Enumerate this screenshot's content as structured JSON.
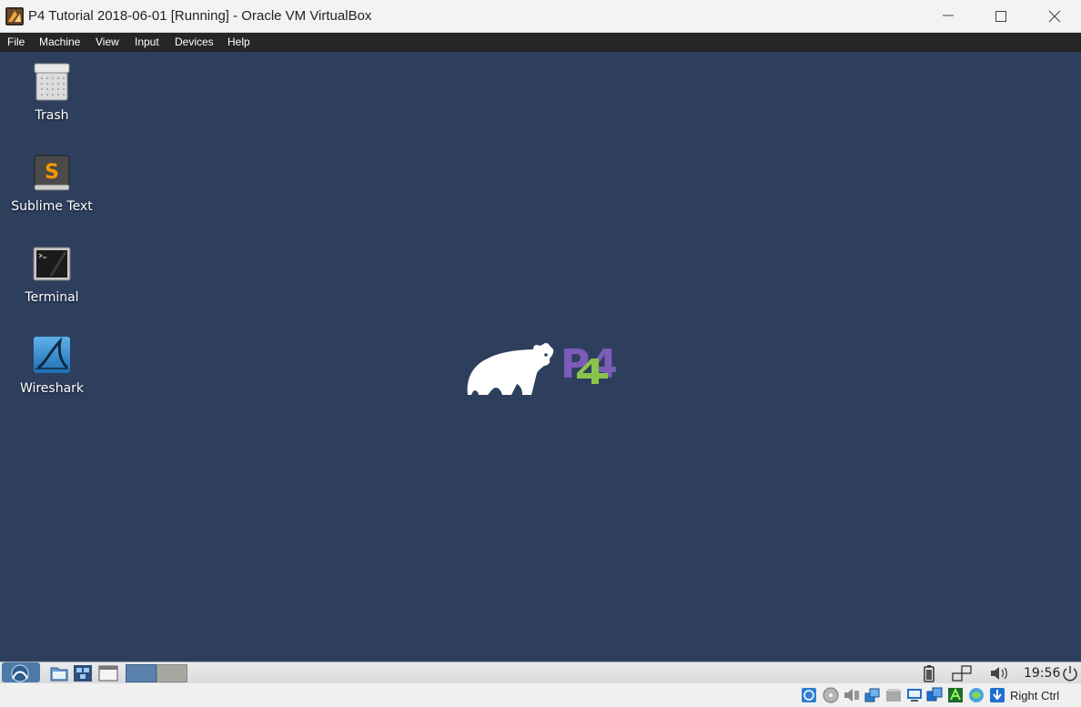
{
  "window": {
    "title": "P4 Tutorial 2018-06-01 [Running] - Oracle VM VirtualBox",
    "app_icon": "virtualbox-icon",
    "controls": [
      "minimize-icon",
      "maximize-icon",
      "close-icon"
    ]
  },
  "menu": {
    "file": "File",
    "machine": "Machine",
    "view": "View",
    "input": "Input",
    "devices": "Devices",
    "help": "Help"
  },
  "desktop": {
    "background_color": "#2e3f5e",
    "icons": [
      {
        "label": "Trash",
        "icon": "trash-icon"
      },
      {
        "label": "Sublime Text",
        "icon": "sublime-text-icon"
      },
      {
        "label": "Terminal",
        "icon": "terminal-icon"
      },
      {
        "label": "Wireshark",
        "icon": "wireshark-icon"
      }
    ],
    "wallpaper_logo": {
      "icon": "p4-bear-logo",
      "mark_text": "P4",
      "colors": [
        "#7b5cb8",
        "#8bc34a"
      ]
    }
  },
  "guest_panel": {
    "launchers": [
      "app-menu-icon",
      "file-manager-icon",
      "network-icon",
      "window-icon"
    ],
    "workspaces": 2,
    "active_workspace": 1,
    "tray": [
      "battery-icon",
      "network-connection-icon",
      "volume-icon",
      "power-icon"
    ],
    "clock": "19:56"
  },
  "status_bar": {
    "indicators": [
      "hard-disk-icon",
      "optical-disk-icon",
      "audio-icon",
      "network-adapter-icon",
      "usb-icon",
      "shared-folder-icon",
      "display-icon",
      "recording-icon",
      "cpu-icon",
      "mouse-integration-icon",
      "keyboard-icon"
    ],
    "host_key": "Right Ctrl"
  }
}
